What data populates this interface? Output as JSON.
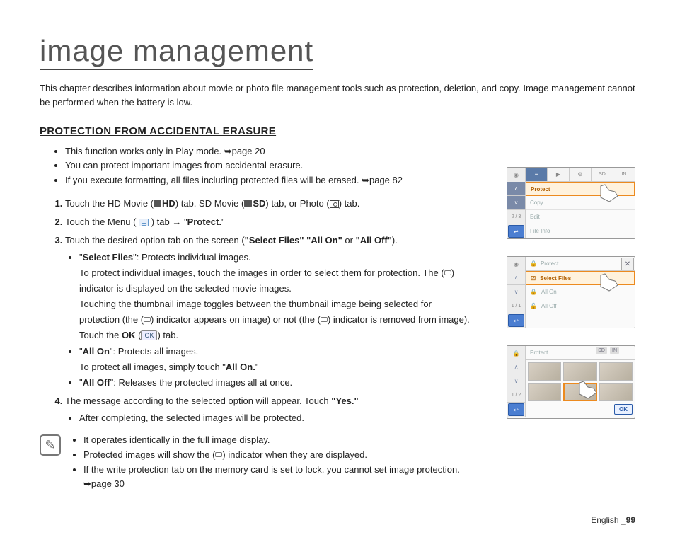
{
  "title": "image management",
  "intro": "This chapter describes information about movie or photo file management tools such as protection, deletion, and copy. Image management cannot be performed when the battery is low.",
  "section_heading": "PROTECTION FROM ACCIDENTAL ERASURE",
  "prereq": {
    "b1": "This function works only in Play mode. ➥page 20",
    "b2": "You can protect important images from accidental erasure.",
    "b3": "If you execute formatting, all files including protected files will be erased. ➥page 82"
  },
  "steps": {
    "s1_a": "Touch the HD Movie (",
    "s1_hd": "HD",
    "s1_b": ") tab, SD Movie (",
    "s1_sd": "SD",
    "s1_c": ") tab, or Photo (",
    "s1_d": ") tab.",
    "s2_a": "Touch the Menu (",
    "s2_b": ") tab ",
    "s2_arrow": "→",
    "s2_c": " \"",
    "s2_protect": "Protect.",
    "s2_d": "\"",
    "s3_a": "Touch the desired option tab on the screen (",
    "s3_opts": "\"Select Files\" \"All On\"",
    "s3_or": " or ",
    "s3_alloff": "\"All Off\"",
    "s3_b": ").",
    "s3_sf_label": "Select Files",
    "s3_sf_desc1": "\": Protects individual images.",
    "s3_sf_desc2": "To protect individual images, touch the images in order to select them for protection. The (",
    "s3_sf_desc3": ") indicator is displayed on the selected movie images.",
    "s3_sf_desc4": "Touching the thumbnail image toggles between the thumbnail image being selected for protection (the (",
    "s3_sf_desc5": ") indicator appears on image) or not (the (",
    "s3_sf_desc6": ") indicator is removed from image). Touch the ",
    "s3_sf_ok": "OK",
    "s3_sf_desc7": " (",
    "s3_sf_okicon": "OK",
    "s3_sf_desc8": ") tab.",
    "s3_ao_label": "All On",
    "s3_ao_desc1": "\": Protects all images.",
    "s3_ao_desc2": "To protect all images, simply touch \"",
    "s3_ao_bold": "All On.",
    "s3_ao_desc3": "\"",
    "s3_af_label": "All Off",
    "s3_af_desc": "\": Releases the protected images all at once.",
    "s4_a": "The message according to the selected option will appear. Touch ",
    "s4_yes": "\"Yes.\"",
    "s4_sub": "After completing, the selected images will be protected."
  },
  "notes": {
    "n1": "It operates identically in the full image display.",
    "n2a": "Protected images will show the (",
    "n2b": ") indicator when they are displayed.",
    "n3": "If the write protection tab on the memory card is set to lock, you cannot set image protection. ➥page 30"
  },
  "footer": {
    "lang": "English ",
    "sep": "_",
    "page": "99"
  },
  "screen1": {
    "page": "2 / 3",
    "rows": {
      "r1": "Protect",
      "r2": "Copy",
      "r3": "Edit",
      "r4": "File Info"
    }
  },
  "screen2": {
    "title": "Protect",
    "page": "1 / 1",
    "rows": {
      "r1": "Select Files",
      "r2": "All On",
      "r3": "All Off"
    }
  },
  "screen3": {
    "title": "Protect",
    "page": "1 / 2",
    "ok": "OK",
    "tags": {
      "a": "SD",
      "b": "IN"
    }
  }
}
